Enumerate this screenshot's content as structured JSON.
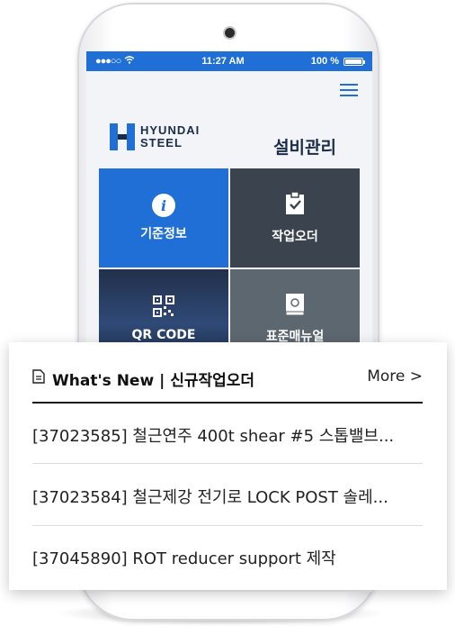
{
  "statusbar": {
    "signal": "●●●○○",
    "time": "11:27 AM",
    "battery": "100 %"
  },
  "brand": {
    "logo_line1": "HYUNDAI",
    "logo_line2": "STEEL",
    "page_title": "설비관리"
  },
  "tiles": [
    {
      "label": "기준정보",
      "icon": "info-icon"
    },
    {
      "label": "작업오더",
      "icon": "clipboard-check-icon"
    },
    {
      "label": "QR CODE",
      "icon": "qr-code-icon"
    },
    {
      "label": "표준매뉴얼",
      "icon": "manual-book-icon"
    }
  ],
  "news": {
    "title": "What's New | 신규작업오더",
    "more_label": "More >",
    "items": [
      "[37023585] 철근연주 400t shear #5 스톱밸브...",
      "[37023584] 철근제강 전기로 LOCK POST 솔레...",
      "[37045890] ROT reducer support 제작"
    ]
  },
  "colors": {
    "accent": "#1f6fd6",
    "dark_tile": "#3b444e",
    "gray_tile": "#5d6770",
    "navy": "#1a2c4a"
  }
}
